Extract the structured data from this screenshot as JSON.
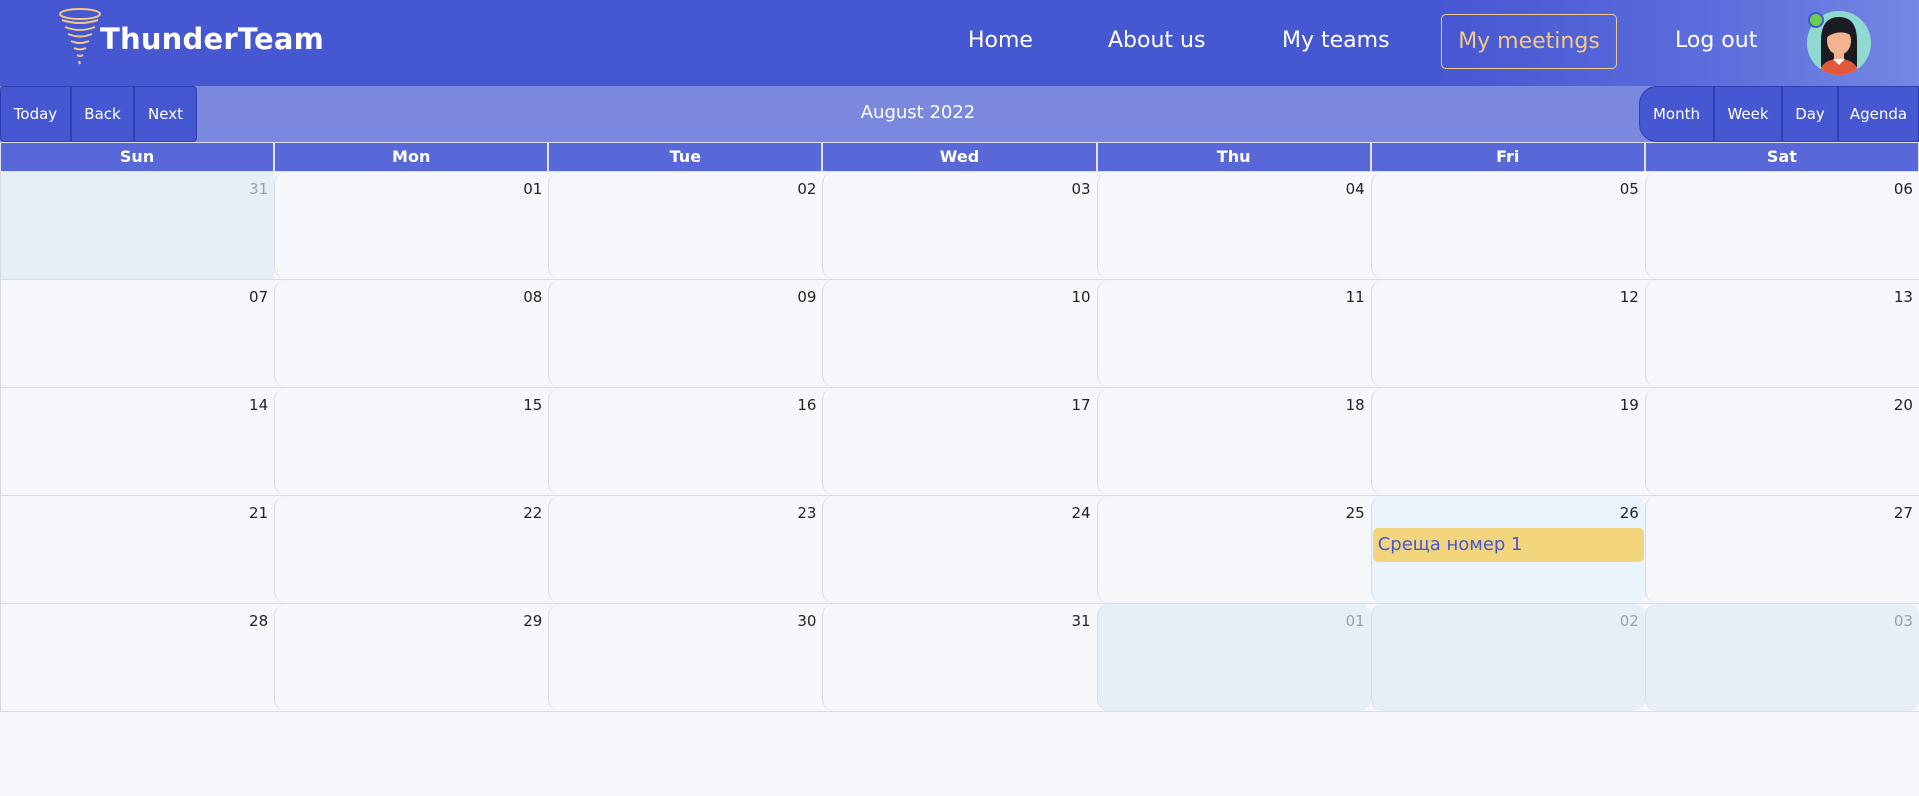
{
  "header": {
    "brand": "ThunderTeam",
    "nav": {
      "home": "Home",
      "about": "About us",
      "teams": "My teams",
      "meetings": "My meetings",
      "logout": "Log out"
    },
    "colors": {
      "bar": "#4657d2",
      "active_nav": "#f2c987",
      "online": "#6ad04b"
    }
  },
  "toolbar": {
    "today": "Today",
    "back": "Back",
    "next": "Next",
    "label": "August 2022",
    "views": {
      "month": "Month",
      "week": "Week",
      "day": "Day",
      "agenda": "Agenda"
    }
  },
  "calendar": {
    "weekdays": [
      "Sun",
      "Mon",
      "Tue",
      "Wed",
      "Thu",
      "Fri",
      "Sat"
    ],
    "weeks": [
      [
        "31",
        "01",
        "02",
        "03",
        "04",
        "05",
        "06"
      ],
      [
        "07",
        "08",
        "09",
        "10",
        "11",
        "12",
        "13"
      ],
      [
        "14",
        "15",
        "16",
        "17",
        "18",
        "19",
        "20"
      ],
      [
        "21",
        "22",
        "23",
        "24",
        "25",
        "26",
        "27"
      ],
      [
        "28",
        "29",
        "30",
        "31",
        "01",
        "02",
        "03"
      ]
    ],
    "event": {
      "title": "Среща номер 1",
      "day": "26"
    }
  }
}
